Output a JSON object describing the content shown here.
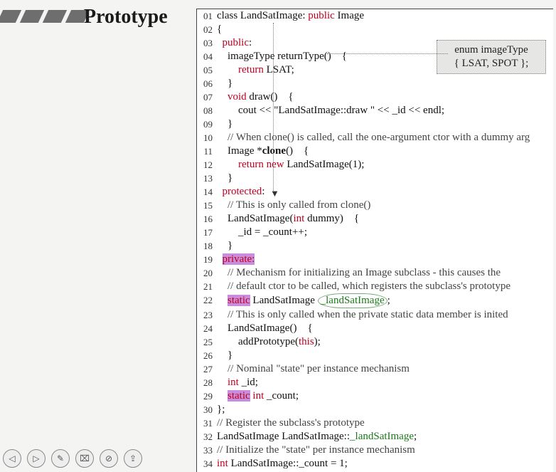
{
  "title": "Prototype",
  "enum_box": {
    "line1": "enum imageType",
    "line2": "{ LSAT, SPOT };"
  },
  "toolbar": {
    "back": "◁",
    "play": "▷",
    "pen": "✎",
    "sheet": "⌧",
    "stop": "⊘",
    "share": "⇪"
  },
  "code": {
    "l01a": "class LandSatImage: ",
    "l01b": "public",
    "l01c": " Image",
    "l02": "{",
    "l03a": "  ",
    "l03b": "public",
    "l03c": ":",
    "l04": "    imageType returnType()    {",
    "l05a": "        ",
    "l05b": "return",
    "l05c": " LSAT;",
    "l06": "    }",
    "l07a": "    ",
    "l07b": "void",
    "l07c": " draw()    {",
    "l08": "        cout << \"LandSatImage::draw \" << _id << endl;",
    "l09": "    }",
    "l10": "    // When clone() is called, call the one-argument ctor with a dummy arg",
    "l11a": "    Image *",
    "l11b": "clone",
    "l11c": "()    {",
    "l12a": "        ",
    "l12b": "return",
    "l12c": " ",
    "l12d": "new",
    "l12e": " LandSatImage(1);",
    "l13": "    }",
    "l14a": "  ",
    "l14b": "protected",
    "l14c": ":",
    "l15": "    // This is only called from clone()",
    "l16a": "    LandSatImage(",
    "l16b": "int",
    "l16c": " dummy)    {",
    "l17": "        _id = _count++;",
    "l18": "    }",
    "l19a": "  ",
    "l19b": "private:",
    "l20": "    // Mechanism for initializing an Image subclass - this causes the",
    "l21": "    // default ctor to be called, which registers the subclass's prototype",
    "l22a": "    ",
    "l22b": "static",
    "l22c": " LandSatImage ",
    "l22d": "_landSatImage",
    "l22e": ";",
    "l23": "    // This is only called when the private static data member is inited",
    "l24": "    LandSatImage()    {",
    "l25a": "        addPrototype(",
    "l25b": "this",
    "l25c": ");",
    "l26": "    }",
    "l27": "    // Nominal \"state\" per instance mechanism",
    "l28a": "    ",
    "l28b": "int",
    "l28c": " _id;",
    "l29a": "    ",
    "l29b": "static",
    "l29c": " ",
    "l29d": "int",
    "l29e": " _count;",
    "l30": "};",
    "l31": "// Register the subclass's prototype",
    "l32a": "LandSatImage LandSatImage::",
    "l32b": "_landSatImage",
    "l32c": ";",
    "l33": "// Initialize the \"state\" per instance mechanism",
    "l34a": "int",
    "l34b": " LandSatImage::_count = 1;"
  },
  "ln": {
    "01": "01",
    "02": "02",
    "03": "03",
    "04": "04",
    "05": "05",
    "06": "06",
    "07": "07",
    "08": "08",
    "09": "09",
    "10": "10",
    "11": "11",
    "12": "12",
    "13": "13",
    "14": "14",
    "15": "15",
    "16": "16",
    "17": "17",
    "18": "18",
    "19": "19",
    "20": "20",
    "21": "21",
    "22": "22",
    "23": "23",
    "24": "24",
    "25": "25",
    "26": "26",
    "27": "27",
    "28": "28",
    "29": "29",
    "30": "30",
    "31": "31",
    "32": "32",
    "33": "33",
    "34": "34"
  }
}
